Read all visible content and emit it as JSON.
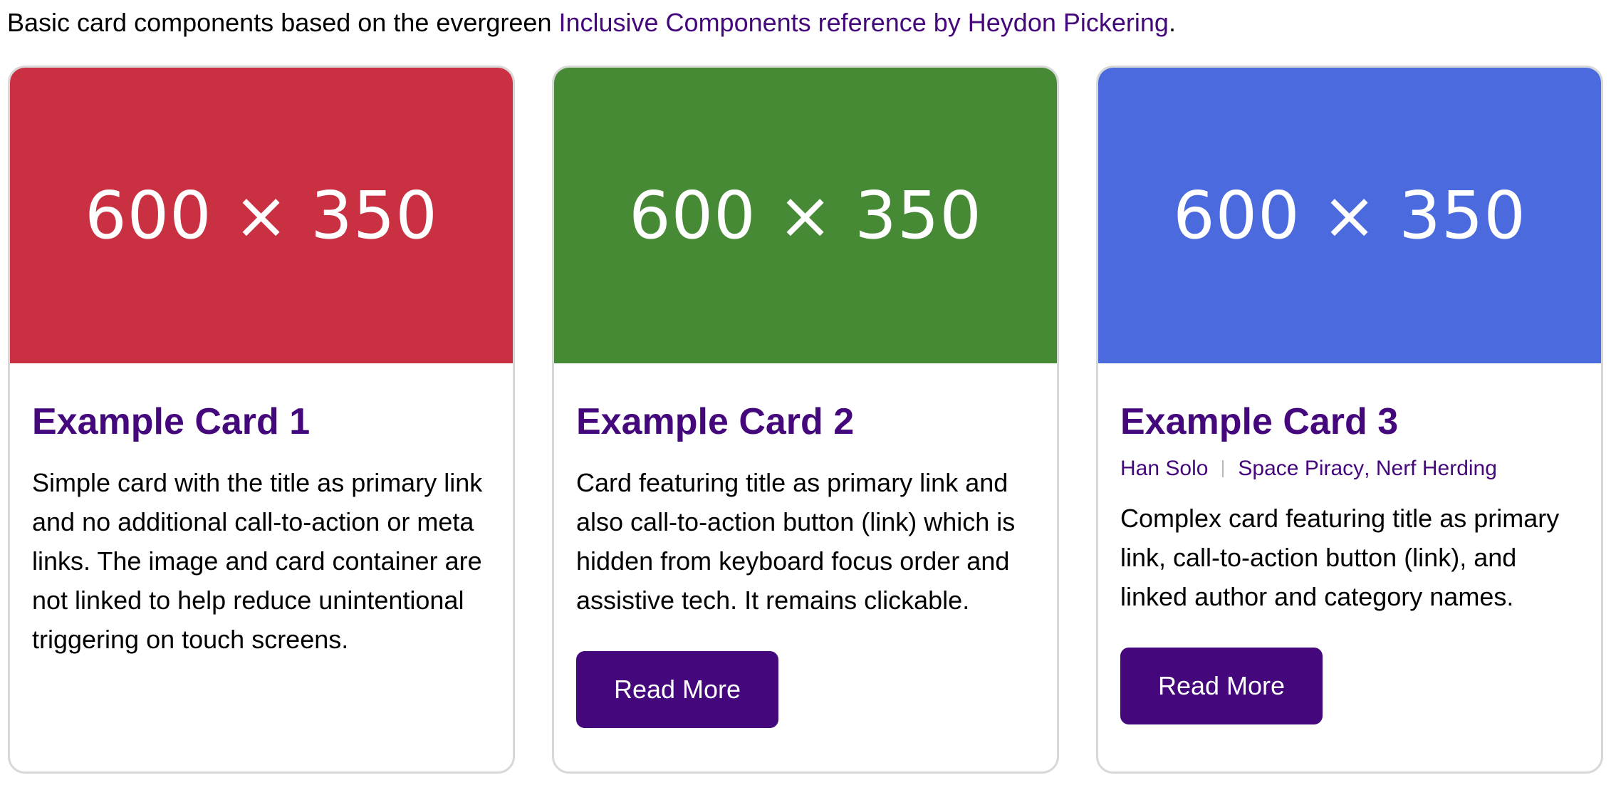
{
  "intro": {
    "text": "Basic card components based on the evergreen ",
    "link_text": "Inclusive Components reference by Heydon Pickering",
    "end": "."
  },
  "colors": {
    "accent": "#45087c",
    "card1_image": "#c93142",
    "card2_image": "#478a35",
    "card3_image": "#4a6ade",
    "border": "#d8d8d8"
  },
  "cards": [
    {
      "image_label": "600 × 350",
      "title": "Example Card 1",
      "text": "Simple card with the title as primary link and no additional call-to-action or meta links. The image and card container are not linked to help reduce unintentional triggering on touch screens."
    },
    {
      "image_label": "600 × 350",
      "title": "Example Card 2",
      "text": "Card featuring title as primary link and also call-to-action button (link) which is hidden from keyboard focus order and assistive tech. It remains clickable.",
      "button": "Read More"
    },
    {
      "image_label": "600 × 350",
      "title": "Example Card 3",
      "author": "Han Solo",
      "category_1": "Space Piracy",
      "category_sep": ", ",
      "category_2": "Nerf Herding",
      "text": "Complex card featuring title as primary link, call-to-action button (link), and linked author and category names.",
      "button": "Read More"
    }
  ]
}
